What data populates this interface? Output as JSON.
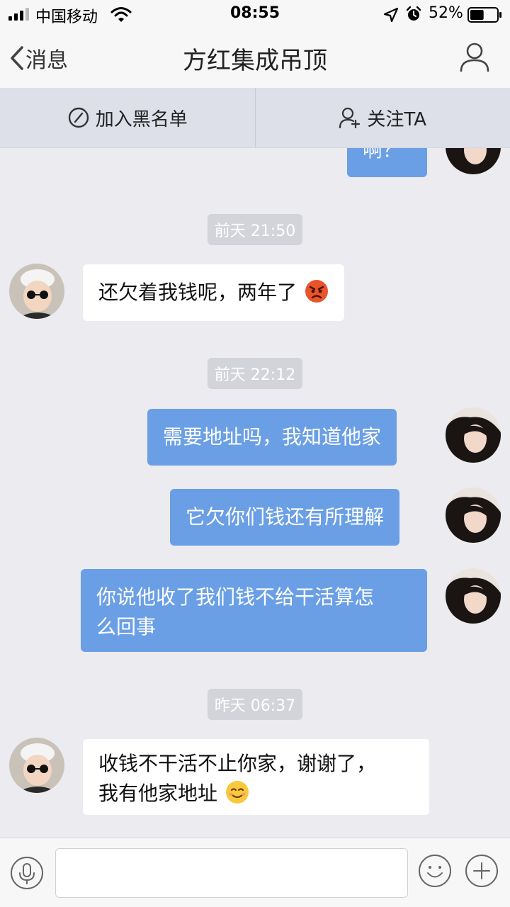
{
  "status_bar": {
    "carrier": "中国移动",
    "time": "08:55",
    "battery_pct": "52%",
    "battery_level": 0.52
  },
  "nav": {
    "back_label": "消息",
    "title": "方红集成吊顶",
    "icons": {
      "back": "chevron-left-icon",
      "profile": "person-icon"
    }
  },
  "actions": {
    "block_label": "加入黑名单",
    "follow_label": "关注TA"
  },
  "messages": [
    {
      "type": "outgoing",
      "text": "啊？"
    },
    {
      "type": "timestamp",
      "text": "前天 21:50"
    },
    {
      "type": "incoming",
      "text": "还欠着我钱呢，两年了",
      "emoji": "angry-face-emoji"
    },
    {
      "type": "timestamp",
      "text": "前天 22:12"
    },
    {
      "type": "outgoing",
      "text": "需要地址吗，我知道他家"
    },
    {
      "type": "outgoing",
      "text": "它欠你们钱还有所理解"
    },
    {
      "type": "outgoing",
      "line1": "你说他收了我们钱不给干活算怎",
      "line2": "么回事"
    },
    {
      "type": "timestamp",
      "text": "昨天 06:37"
    },
    {
      "type": "incoming",
      "line1": "收钱不干活不止你家，谢谢了，",
      "line2": "我有他家地址",
      "emoji": "smiling-face-emoji"
    }
  ],
  "input": {
    "value": "",
    "placeholder": ""
  },
  "colors": {
    "outgoing_bubble": "#6a9fe6",
    "incoming_bubble": "#ffffff",
    "chat_background": "#ebebf0"
  }
}
